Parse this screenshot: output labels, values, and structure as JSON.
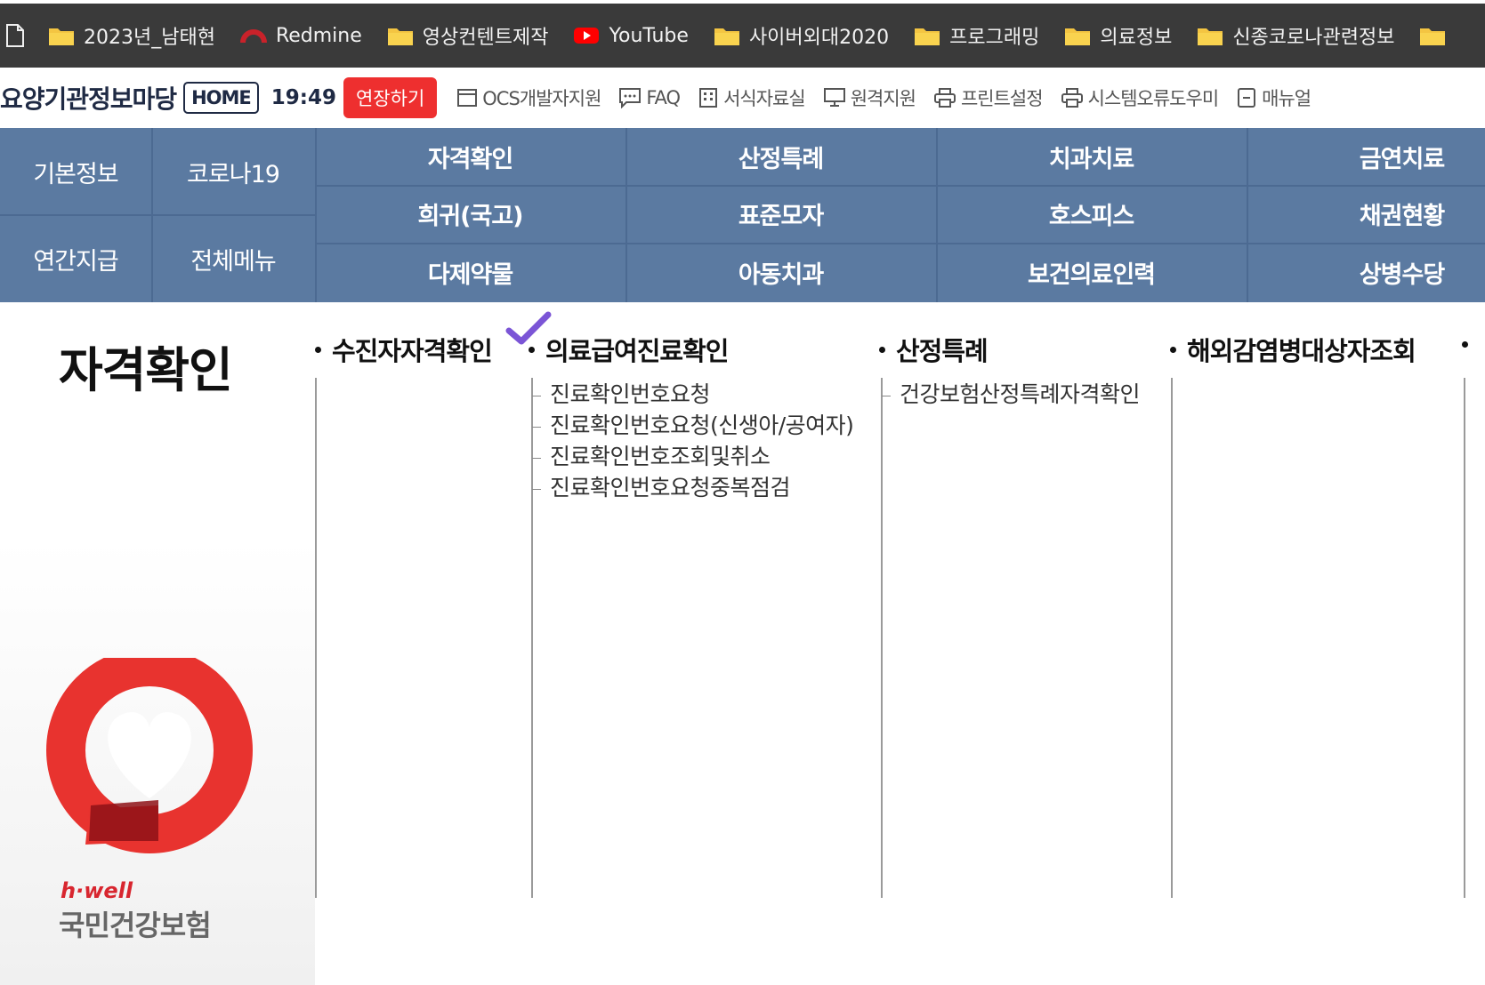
{
  "bookmarks": [
    {
      "label": "2023년_남태현",
      "icon": "folder-icon"
    },
    {
      "label": "Redmine",
      "icon": "redmine-icon"
    },
    {
      "label": "영상컨텐트제작",
      "icon": "folder-icon"
    },
    {
      "label": "YouTube",
      "icon": "youtube-icon"
    },
    {
      "label": "사이버외대2020",
      "icon": "folder-icon"
    },
    {
      "label": "프로그래밍",
      "icon": "folder-icon"
    },
    {
      "label": "의료정보",
      "icon": "folder-icon"
    },
    {
      "label": "신종코로나관련정보",
      "icon": "folder-icon"
    }
  ],
  "header": {
    "site_title": "요양기관정보마당",
    "home_label": "HOME",
    "clock": "19:49",
    "extend_label": "연장하기",
    "utilities": [
      {
        "label": "OCS개발자지원",
        "icon": "window-icon"
      },
      {
        "label": "FAQ",
        "icon": "chat-icon"
      },
      {
        "label": "서식자료실",
        "icon": "building-icon"
      },
      {
        "label": "원격지원",
        "icon": "monitor-icon"
      },
      {
        "label": "프린트설정",
        "icon": "printer-icon"
      },
      {
        "label": "시스템오류도우미",
        "icon": "printer-icon"
      },
      {
        "label": "매뉴얼",
        "icon": "manual-icon"
      }
    ]
  },
  "nav": {
    "left": [
      "기본정보",
      "코로나19",
      "연간지급",
      "전체메뉴"
    ],
    "grid": [
      [
        "자격확인",
        "산정특례",
        "치과치료",
        "금연치료"
      ],
      [
        "희귀(국고)",
        "표준모자",
        "호스피스",
        "채권현황"
      ],
      [
        "다제약물",
        "아동치과",
        "보건의료인력",
        "상병수당"
      ]
    ]
  },
  "content": {
    "section_title": "자격확인",
    "columns": [
      {
        "title": "수진자자격확인",
        "items": []
      },
      {
        "title": "의료급여진료확인",
        "items": [
          "진료확인번호요청",
          "진료확인번호요청(신생아/공여자)",
          "진료확인번호조회및취소",
          "진료확인번호요청중복점검"
        ]
      },
      {
        "title": "산정특례",
        "items": [
          "건강보험산정특례자격확인"
        ]
      },
      {
        "title": "해외감염병대상자조회",
        "items": []
      }
    ]
  },
  "logo": {
    "en": "h·well",
    "ko": "국민건강보험"
  },
  "colors": {
    "nav_bg": "#5b7aa1",
    "extend_btn": "#ee2f2f",
    "bookmark_bar": "#3a3a3a",
    "logo_red": "#e8332f"
  }
}
